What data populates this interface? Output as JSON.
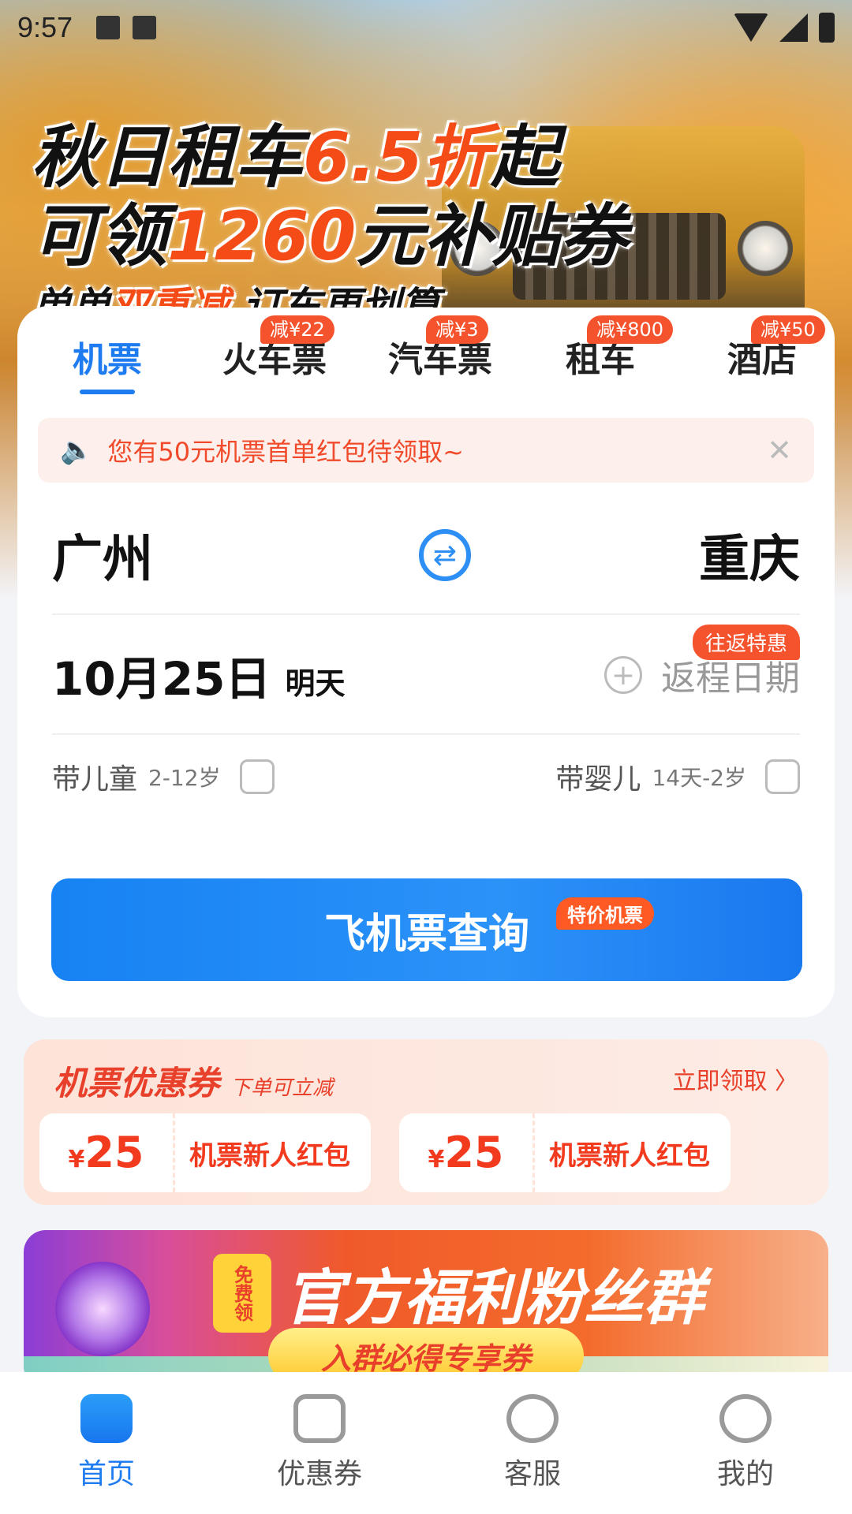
{
  "status_bar": {
    "time": "9:57"
  },
  "promo": {
    "line1_a": "秋日租车",
    "line1_b": "6.5折",
    "line1_c": "起",
    "line2_a": "可领",
    "line2_b": "1260",
    "line2_c": "元补贴券",
    "line3_a": "单单",
    "line3_b": "双重减",
    "line3_c": " 订车更划算"
  },
  "tabs": [
    {
      "label": "机票",
      "active": true,
      "badge": ""
    },
    {
      "label": "火车票",
      "badge": "减¥22"
    },
    {
      "label": "汽车票",
      "badge": "减¥3"
    },
    {
      "label": "租车",
      "badge": "减¥800"
    },
    {
      "label": "酒店",
      "badge": "减¥50"
    }
  ],
  "notice": {
    "text": "您有50元机票首单红包待领取~",
    "close": "✕"
  },
  "route": {
    "from": "广州",
    "to": "重庆"
  },
  "date": {
    "depart": "10月25日",
    "depart_sub": "明天",
    "return_label": "返程日期",
    "return_badge": "往返特惠"
  },
  "passengers": {
    "child_label": "带儿童",
    "child_age": "2-12岁",
    "infant_label": "带婴儿",
    "infant_age": "14天-2岁"
  },
  "search_button": {
    "label": "飞机票查询",
    "badge": "特价机票"
  },
  "coupons": {
    "title": "机票优惠券",
    "subtitle": "下单可立减",
    "more": "立即领取 〉",
    "items": [
      {
        "currency": "¥",
        "amount": "25",
        "desc": "机票新人红包"
      },
      {
        "currency": "¥",
        "amount": "25",
        "desc": "机票新人红包"
      }
    ]
  },
  "fan_banner": {
    "free_tag": "免费领",
    "title": "官方福利粉丝群",
    "pill": "入群必得专享券"
  },
  "bottom_nav": [
    {
      "label": "首页",
      "icon": "home-icon",
      "active": true
    },
    {
      "label": "优惠券",
      "icon": "ticket-icon"
    },
    {
      "label": "客服",
      "icon": "chat-bot-icon"
    },
    {
      "label": "我的",
      "icon": "profile-icon"
    }
  ],
  "colors": {
    "accent": "#1f7cf0",
    "promo_red": "#f5532d"
  }
}
